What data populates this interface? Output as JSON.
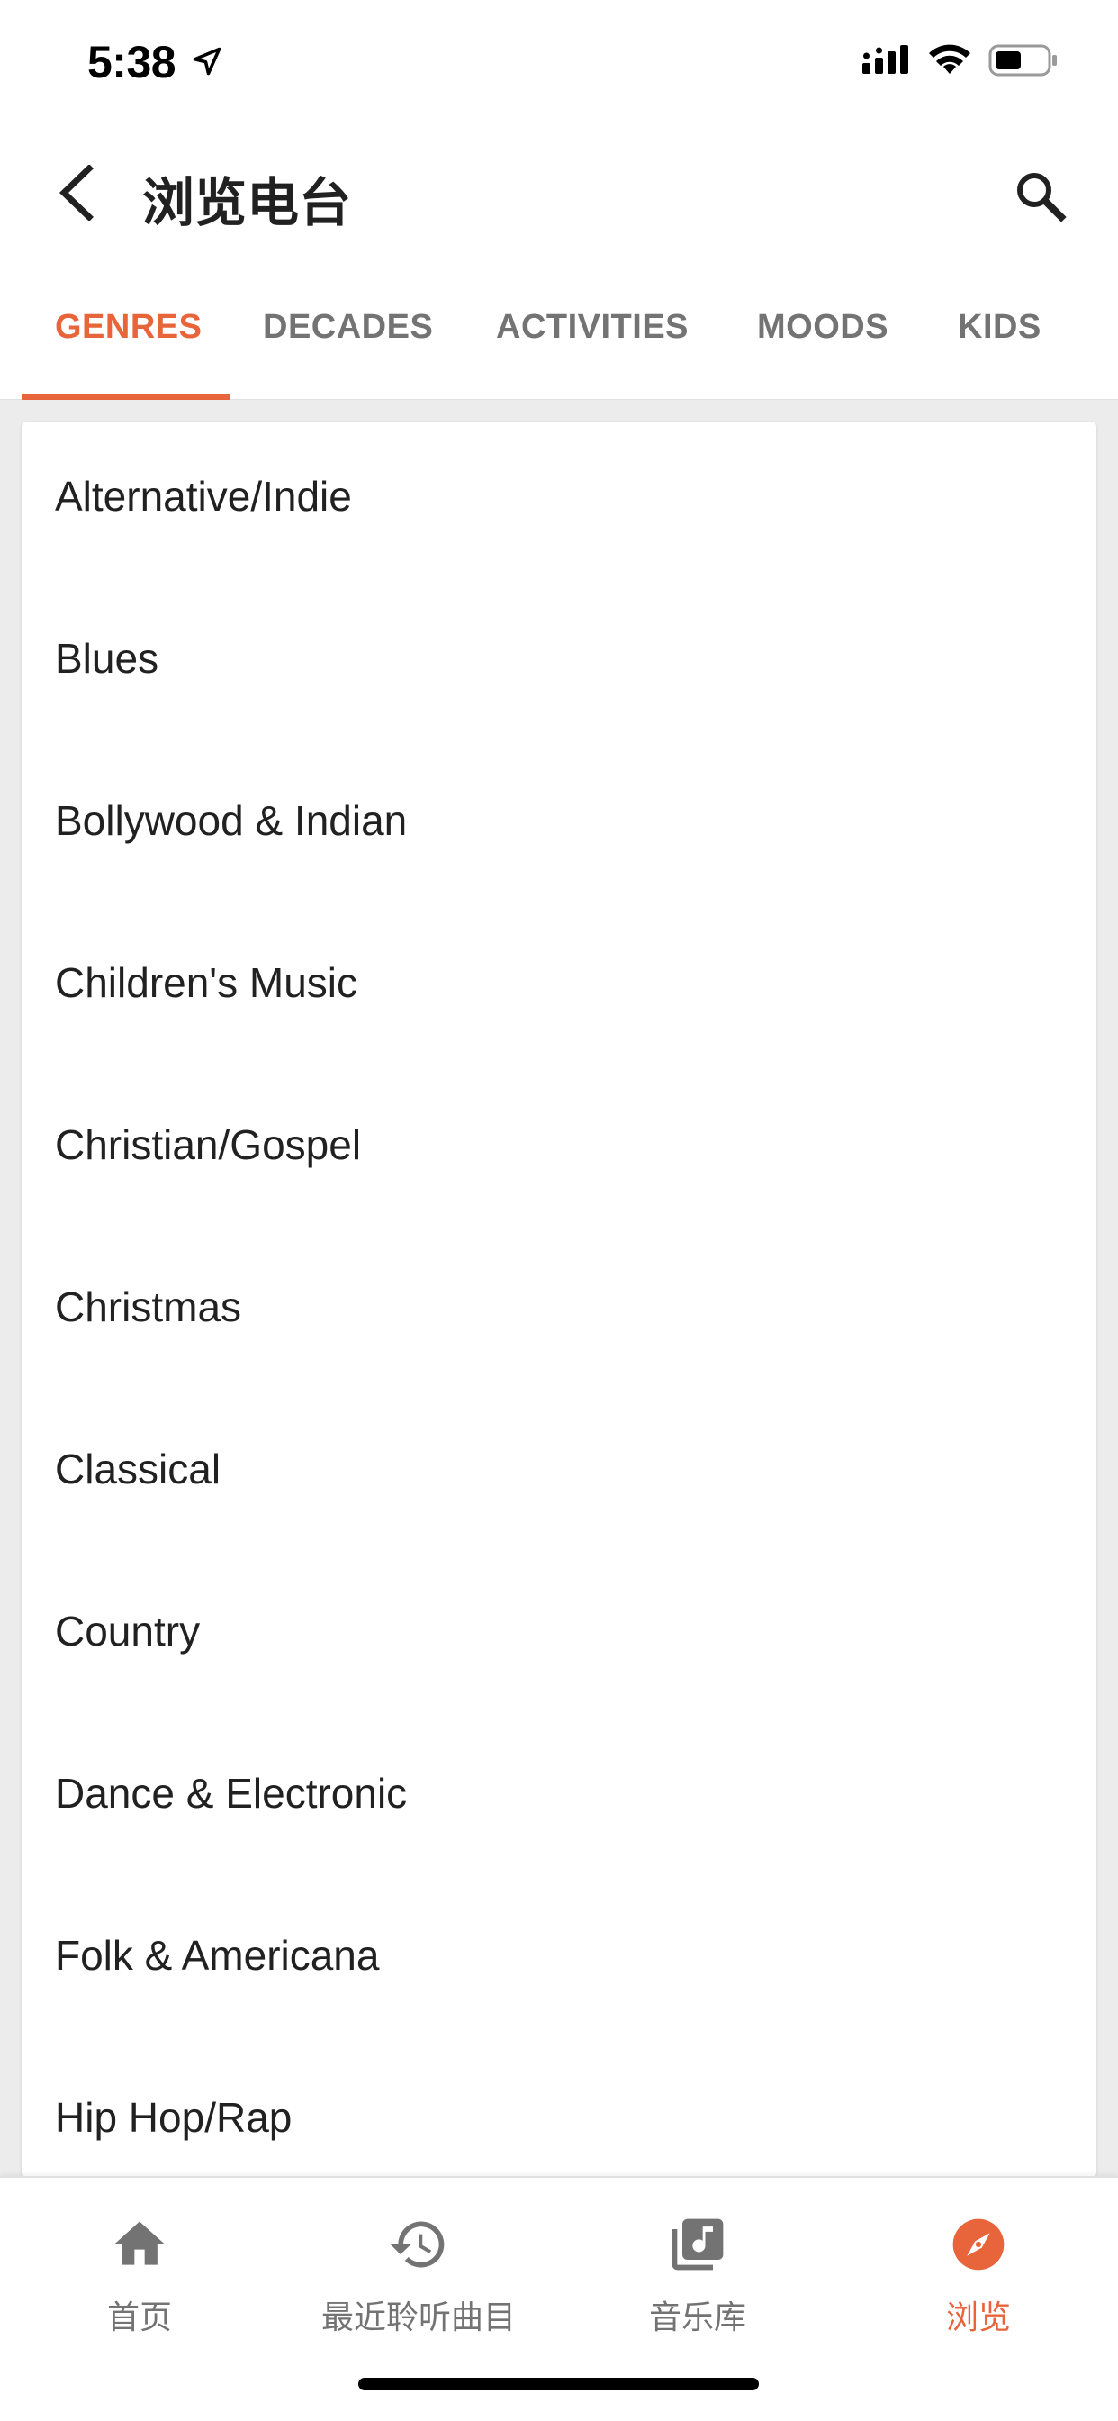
{
  "status_bar": {
    "time": "5:38"
  },
  "header": {
    "title": "浏览电台"
  },
  "tabs": [
    {
      "label": "GENRES",
      "active": true
    },
    {
      "label": "DECADES",
      "active": false
    },
    {
      "label": "ACTIVITIES",
      "active": false
    },
    {
      "label": "MOODS",
      "active": false
    },
    {
      "label": "KIDS",
      "active": false
    }
  ],
  "genres": [
    "Alternative/Indie",
    "Blues",
    "Bollywood & Indian",
    "Children's Music",
    "Christian/Gospel",
    "Christmas",
    "Classical",
    "Country",
    "Dance & Electronic",
    "Folk & Americana",
    "Hip Hop/Rap"
  ],
  "bottom_nav": [
    {
      "label": "首页",
      "icon": "home-icon",
      "active": false
    },
    {
      "label": "最近聆听曲目",
      "icon": "history-icon",
      "active": false
    },
    {
      "label": "音乐库",
      "icon": "library-icon",
      "active": false
    },
    {
      "label": "浏览",
      "icon": "compass-icon",
      "active": true
    }
  ],
  "colors": {
    "accent": "#e8643a",
    "inactive_text": "#737373",
    "primary_text": "#212121",
    "background": "#ececec"
  }
}
